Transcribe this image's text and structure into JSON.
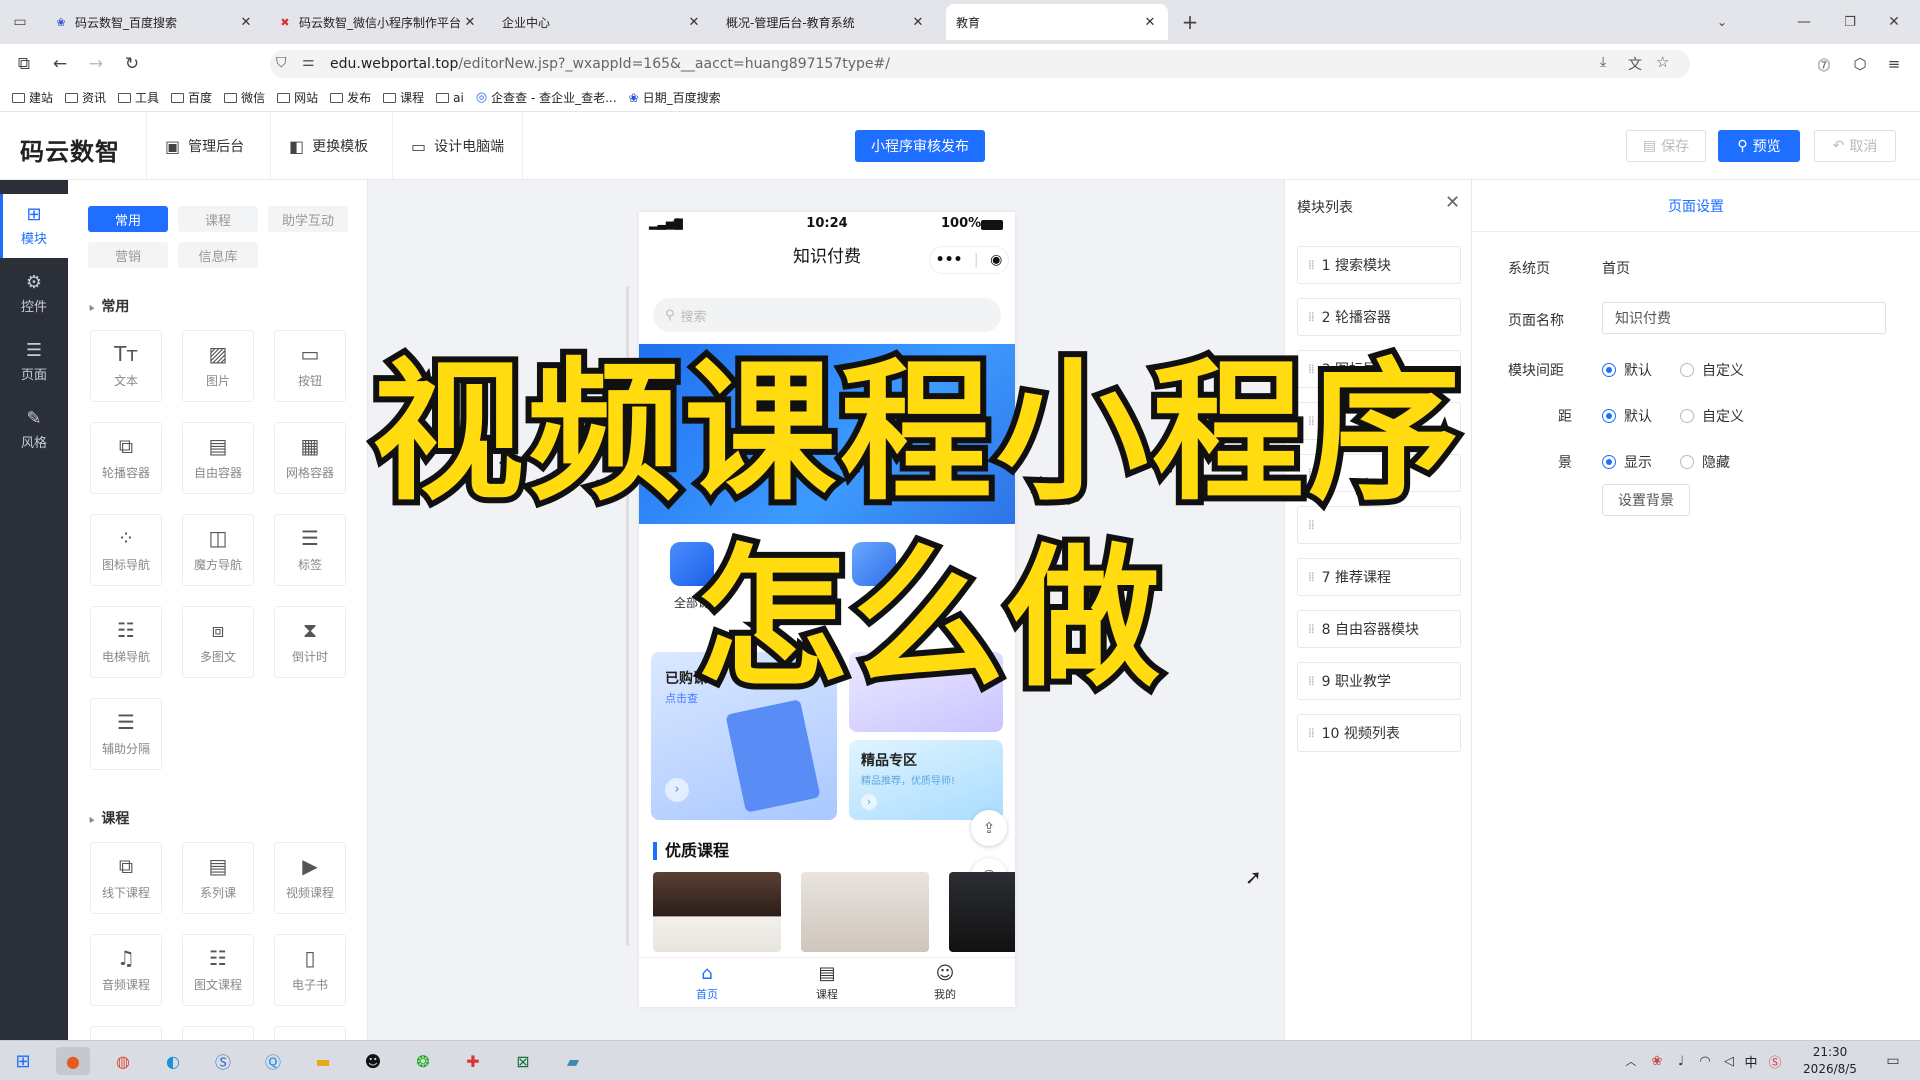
{
  "browser": {
    "tabs": [
      {
        "label": "码云数智_百度搜索",
        "icon": "paw-icon"
      },
      {
        "label": "码云数智_微信小程序制作平台",
        "icon": "x-logo-icon"
      },
      {
        "label": "企业中心",
        "icon": ""
      },
      {
        "label": "概况-管理后台-教育系统",
        "icon": ""
      },
      {
        "label": "教育",
        "icon": ""
      }
    ],
    "active_tab": 4,
    "url_domain": "edu.webportal.top",
    "url_path": "/editorNew.jsp?_wxappId=165&__aacct=huang897157type#/",
    "bookmarks": [
      "建站",
      "资讯",
      "工具",
      "百度",
      "微信",
      "网站",
      "发布",
      "课程",
      "ai",
      "企查查 - 查企业_查老...",
      "日期_百度搜索"
    ]
  },
  "header": {
    "logo": "码云数智",
    "nav": [
      "管理后台",
      "更换模板",
      "设计电脑端"
    ],
    "publish": "小程序审核发布",
    "save": "保存",
    "preview": "预览",
    "cancel": "取消"
  },
  "sidebar": {
    "items": [
      {
        "label": "模块",
        "icon": "plus-square-icon"
      },
      {
        "label": "控件",
        "icon": "sliders-icon"
      },
      {
        "label": "页面",
        "icon": "pages-icon"
      },
      {
        "label": "风格",
        "icon": "brush-icon"
      }
    ]
  },
  "components": {
    "tabs": [
      "常用",
      "课程",
      "助学互动",
      "营销",
      "信息库"
    ],
    "section_common": "常用",
    "common": [
      "文本",
      "图片",
      "按钮",
      "轮播容器",
      "自由容器",
      "网格容器",
      "图标导航",
      "魔方导航",
      "标签",
      "电梯导航",
      "多图文",
      "倒计时",
      "辅助分隔"
    ],
    "section_course": "课程",
    "course": [
      "线下课程",
      "系列课",
      "视频课程",
      "音频课程",
      "图文课程",
      "电子书"
    ]
  },
  "phone": {
    "time": "10:24",
    "battery": "100%",
    "title": "知识付费",
    "search_placeholder": "搜索",
    "icon_label_1": "全部课",
    "bought_title": "已购课",
    "bought_sub": "点击查",
    "premium_title": "精品专区",
    "premium_sub": "精品推荐，优质导师!",
    "section_title": "优质课程",
    "tabs": [
      "首页",
      "课程",
      "我的"
    ]
  },
  "module_list": {
    "title": "模块列表",
    "items": [
      "1 搜索模块",
      "2 轮播容器",
      "3 图标导航",
      "7 推荐课程",
      "8 自由容器模块",
      "9 职业教学",
      "10 视频列表"
    ]
  },
  "page_settings": {
    "title": "页面设置",
    "system_page_label": "系统页",
    "system_page_value": "首页",
    "page_name_label": "页面名称",
    "page_name_value": "知识付费",
    "spacing_label": "模块间距",
    "opt_default": "默认",
    "opt_custom": "自定义",
    "row2_label": "距",
    "row3_label": "景",
    "opt_show": "显示",
    "opt_hide": "隐藏",
    "set_bg": "设置背景"
  },
  "overlay": {
    "line1": "视频课程小程序",
    "line2": "怎么做"
  },
  "taskbar": {
    "time": "21:30",
    "date": "2026/8/5",
    "ime": "中"
  },
  "colors": {
    "accent": "#1e6fff",
    "overlay_text": "#ffdb10",
    "sidebar": "#2b2f38"
  }
}
